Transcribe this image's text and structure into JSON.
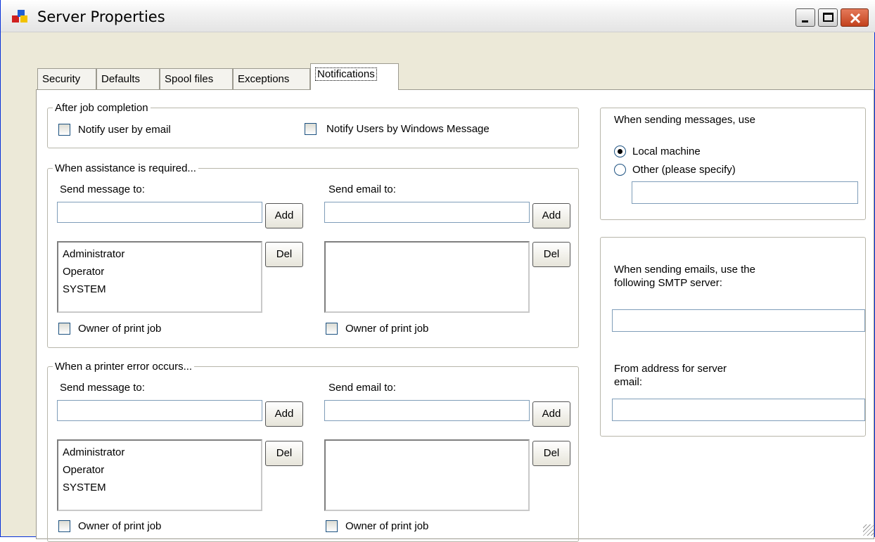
{
  "window": {
    "title": "Server Properties"
  },
  "tabs": [
    {
      "label": "Security"
    },
    {
      "label": "Defaults"
    },
    {
      "label": "Spool files"
    },
    {
      "label": "Exceptions"
    },
    {
      "label": "Notifications",
      "active": true
    }
  ],
  "after_job": {
    "legend": "After job completion",
    "notify_email_label": "Notify user by email",
    "notify_windows_label": "Notify Users by Windows Message",
    "notify_email_checked": false,
    "notify_windows_checked": false
  },
  "assistance": {
    "legend": "When assistance is required...",
    "send_message_label": "Send message to:",
    "send_email_label": "Send email to:",
    "message_input_value": "",
    "email_input_value": "",
    "add_label": "Add",
    "del_label": "Del",
    "message_list": [
      "Administrator",
      "Operator",
      "SYSTEM"
    ],
    "email_list": [],
    "owner_label_1": "Owner of print job",
    "owner_label_2": "Owner of print job"
  },
  "printer_error": {
    "legend": "When a printer error occurs...",
    "send_message_label": "Send message to:",
    "send_email_label": "Send email to:",
    "message_input_value": "",
    "email_input_value": "",
    "add_label": "Add",
    "del_label": "Del",
    "message_list": [
      "Administrator",
      "Operator",
      "SYSTEM"
    ],
    "email_list": [],
    "owner_label_1": "Owner of print job",
    "owner_label_2": "Owner of print job"
  },
  "messages_panel": {
    "heading": "When sending messages, use",
    "local_label": "Local machine",
    "other_label": "Other (please specify)",
    "selected": "Local machine",
    "other_value": ""
  },
  "email_panel": {
    "smtp_label_line1": "When sending emails, use the",
    "smtp_label_line2": "following SMTP server:",
    "smtp_value": "",
    "from_label_line1": "From address for server",
    "from_label_line2": "email:",
    "from_value": ""
  },
  "colors": {
    "titlebar": "#ececec",
    "close_button": "#d4532d",
    "panel_bg": "#ffffff",
    "border": "#9c9a8f"
  }
}
